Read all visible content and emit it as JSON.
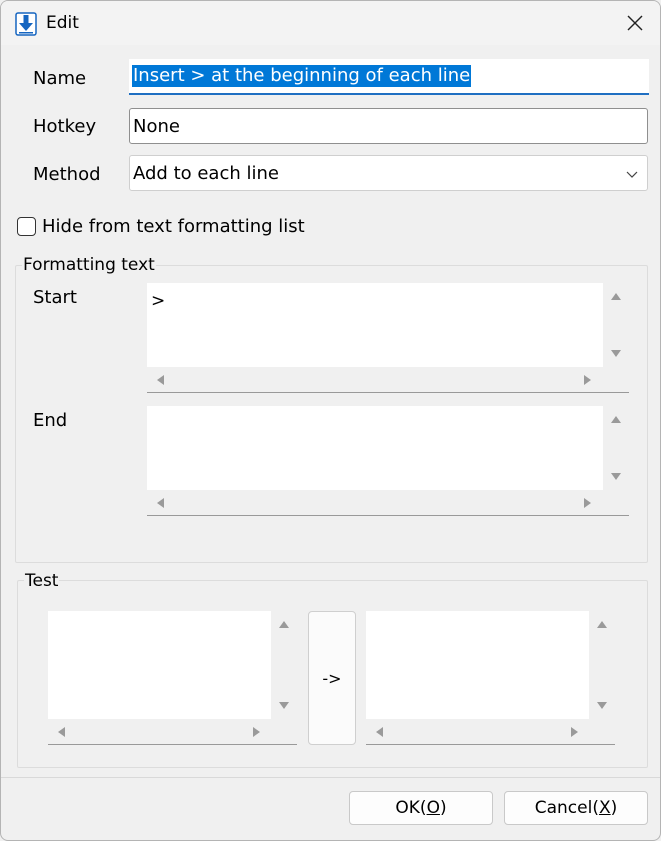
{
  "window": {
    "title": "Edit"
  },
  "fields": {
    "name_label": "Name",
    "name_value": "Insert > at the beginning of each line",
    "hotkey_label": "Hotkey",
    "hotkey_value": "None",
    "method_label": "Method",
    "method_value": "Add to each line"
  },
  "checkbox": {
    "label": "Hide from text formatting list",
    "checked": false
  },
  "formatting": {
    "title": "Formatting text",
    "start_label": "Start",
    "start_value": ">",
    "end_label": "End",
    "end_value": ""
  },
  "test": {
    "title": "Test",
    "convert_label": "->"
  },
  "buttons": {
    "ok_prefix": "OK(",
    "ok_key": "O",
    "ok_suffix": ")",
    "cancel_prefix": "Cancel(",
    "cancel_key": "X",
    "cancel_suffix": ")"
  },
  "colors": {
    "accent": "#0078d7",
    "icon_blue": "#1565c0"
  }
}
